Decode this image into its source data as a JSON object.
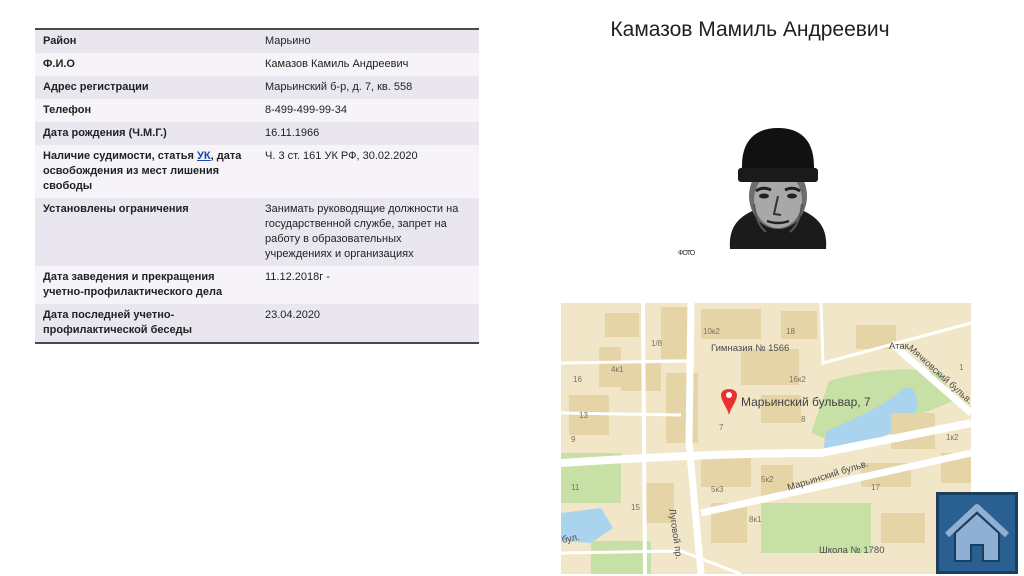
{
  "person_name": "Камазов Мамиль Андреевич",
  "table": {
    "rows": [
      {
        "key": "Район",
        "value": "Марьино"
      },
      {
        "key": "Ф.И.О",
        "value": "Камазов Камиль Андреевич"
      },
      {
        "key": "Адрес регистрации",
        "value": "Марьинский б-р, д. 7, кв. 558"
      },
      {
        "key": "Телефон",
        "value": "8-499-499-99-34"
      },
      {
        "key": "Дата рождения (Ч.М.Г.)",
        "value": "16.11.1966"
      },
      {
        "key_prefix": "Наличие судимости, статья ",
        "key_link": "УК",
        "key_suffix": ", дата освобождения из мест лишения свободы",
        "value": "Ч. 3 ст. 161 УК РФ, 30.02.2020"
      },
      {
        "key": "Установлены ограничения",
        "value": "Занимать руководящие должности на государственной службе, запрет на работу в образовательных учреждениях и организациях"
      },
      {
        "key": "Дата заведения и прекращения учетно-профилактического дела",
        "value": "11.12.2018г -"
      },
      {
        "key": "Дата последней учетно-профилактической беседы",
        "value": "23.04.2020"
      }
    ]
  },
  "photo_caption": "ФОТО",
  "map": {
    "address_marker": "Марьинский бульвар, 7",
    "labels": {
      "school_1566": "Гимназия № 1566",
      "school_1780": "Школа № 1780",
      "atak": "Атак",
      "boulevard": "Марьинский бульв.",
      "myachkovsky": "Мячковский бульв.",
      "lugovoy": "Луговой пр.",
      "b10k2": "10к2",
      "b16k2": "16к2",
      "b18": "18",
      "b4k1": "4к1",
      "b1_8": "1/8",
      "b5k3": "5к3",
      "b5k2": "5к2",
      "b13": "13",
      "b7": "7",
      "b1": "1",
      "b8": "8",
      "b1k2": "1к2",
      "b16": "16",
      "b9": "9",
      "b11": "11",
      "b15": "15",
      "b17": "17",
      "b8k1": "8к1",
      "bul": "бул."
    },
    "colors": {
      "background": "#f1e7c8",
      "building": "#e4d4a6",
      "green": "#c7e0a6",
      "water": "#aad3ee",
      "road": "#ffffff",
      "pin": "#e8322d"
    }
  },
  "home_button": {
    "icon": "home-icon",
    "color": "#2a5f92"
  }
}
